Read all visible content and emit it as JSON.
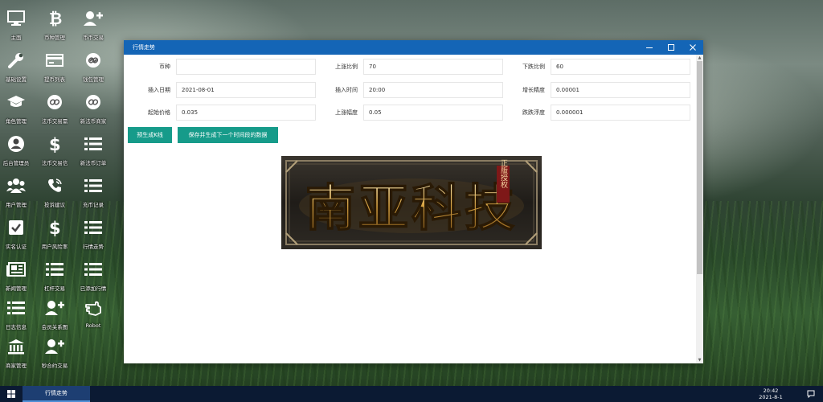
{
  "desktop": {
    "icons": [
      {
        "label": "主面",
        "icon": "monitor-icon"
      },
      {
        "label": "币种管理",
        "icon": "bitcoin-icon"
      },
      {
        "label": "币币交易",
        "icon": "user-plus-icon"
      },
      {
        "label": "基础设置",
        "icon": "wrench-icon"
      },
      {
        "label": "提币列表",
        "icon": "card-icon"
      },
      {
        "label": "钱包管理",
        "icon": "link-icon"
      },
      {
        "label": "角色管理",
        "icon": "graduation-cap-icon"
      },
      {
        "label": "法币交易需",
        "icon": "link-icon"
      },
      {
        "label": "新法币商家",
        "icon": "link-icon"
      },
      {
        "label": "后台管理员",
        "icon": "user-circle-icon"
      },
      {
        "label": "法币交易信",
        "icon": "dollar-icon"
      },
      {
        "label": "新法币订单",
        "icon": "list-icon"
      },
      {
        "label": "用户管理",
        "icon": "users-icon"
      },
      {
        "label": "投诉建议",
        "icon": "phone-icon"
      },
      {
        "label": "充币记录",
        "icon": "list-icon"
      },
      {
        "label": "实名认证",
        "icon": "check-square-icon"
      },
      {
        "label": "用户风险率",
        "icon": "dollar-icon"
      },
      {
        "label": "行情走势",
        "icon": "list-icon"
      },
      {
        "label": "新闻管理",
        "icon": "newspaper-icon"
      },
      {
        "label": "杠杆交易",
        "icon": "list-icon"
      },
      {
        "label": "已添加行情",
        "icon": "list-icon"
      },
      {
        "label": "日志信息",
        "icon": "list-icon"
      },
      {
        "label": "会员关系图",
        "icon": "user-plus-icon"
      },
      {
        "label": "Robot",
        "icon": "hand-icon"
      },
      {
        "label": "商家管理",
        "icon": "bank-icon"
      },
      {
        "label": "秒合约交易",
        "icon": "user-plus-icon"
      }
    ]
  },
  "window": {
    "title": "行情走势",
    "controls": {
      "minimize": "minimize-icon",
      "maximize": "maximize-icon",
      "close": "close-icon"
    }
  },
  "form": {
    "currency": {
      "label": "币种",
      "value": ""
    },
    "rise_ratio": {
      "label": "上涨比例",
      "value": "70"
    },
    "fall_ratio": {
      "label": "下跌比例",
      "value": "60"
    },
    "insert_date": {
      "label": "插入日期",
      "value": "2021-08-01"
    },
    "insert_time": {
      "label": "插入时间",
      "value": "20:00"
    },
    "growth_precision": {
      "label": "增长精度",
      "value": "0.00001"
    },
    "start_price": {
      "label": "起始价格",
      "value": "0.035"
    },
    "rise_amplitude": {
      "label": "上涨幅度",
      "value": "0.05"
    },
    "fall_float": {
      "label": "跌跌浮度",
      "value": "0.000001"
    }
  },
  "buttons": {
    "pregen": "预生成K线",
    "save": "保存并生成下一个时间段的数据"
  },
  "banner": {
    "title": "南亚科技",
    "seal": "正版授权"
  },
  "taskbar": {
    "active_item": "行情走势",
    "time": "20:42",
    "date": "2021-8-1"
  },
  "colors": {
    "titlebar": "#1465b6",
    "button": "#169b8a",
    "taskbar": "#0b1a33"
  }
}
